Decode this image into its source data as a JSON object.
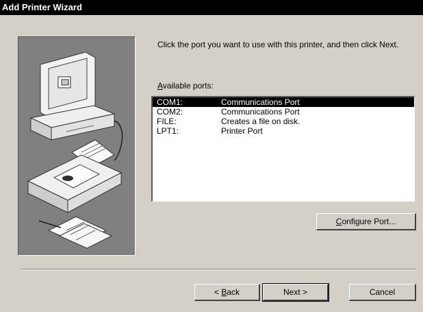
{
  "window": {
    "title": "Add Printer Wizard"
  },
  "instruction": "Click the port you want to use with this printer, and then click Next.",
  "available_ports": {
    "label_hotkey": "A",
    "label_rest": "vailable ports:",
    "items": [
      {
        "port": "COM1:",
        "description": "Communications Port",
        "selected": true
      },
      {
        "port": "COM2:",
        "description": "Communications Port",
        "selected": false
      },
      {
        "port": "FILE:",
        "description": "Creates a file on disk.",
        "selected": false
      },
      {
        "port": "LPT1:",
        "description": "Printer Port",
        "selected": false
      }
    ]
  },
  "buttons": {
    "configure_hotkey": "C",
    "configure_rest": "onfigure Port...",
    "back_prefix": "< ",
    "back_hotkey": "B",
    "back_rest": "ack",
    "next": "Next >",
    "cancel": "Cancel"
  }
}
